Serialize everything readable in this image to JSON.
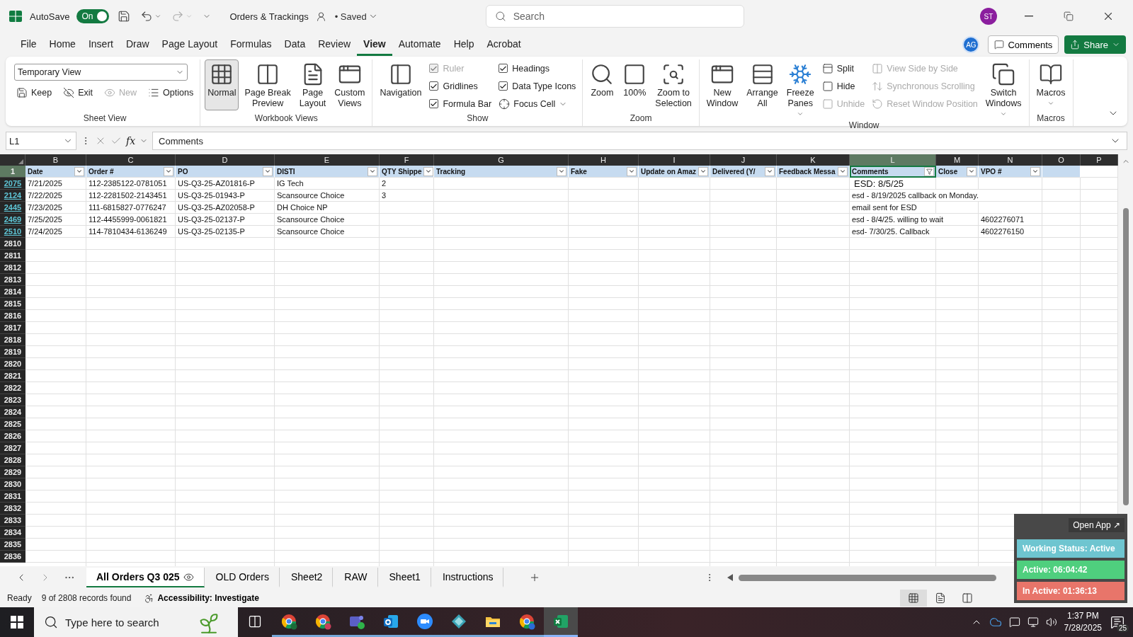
{
  "title_bar": {
    "autosave_label": "AutoSave",
    "autosave": {
      "label": "On",
      "on": true
    },
    "document_title": "Orders & Trackings",
    "save_status": "• Saved",
    "search": {
      "placeholder": "Search"
    },
    "user_initials": "ST"
  },
  "menu_tabs": [
    {
      "label": "File",
      "selected": false
    },
    {
      "label": "Home",
      "selected": false
    },
    {
      "label": "Insert",
      "selected": false
    },
    {
      "label": "Draw",
      "selected": false
    },
    {
      "label": "Page Layout",
      "selected": false
    },
    {
      "label": "Formulas",
      "selected": false
    },
    {
      "label": "Data",
      "selected": false
    },
    {
      "label": "Review",
      "selected": false
    },
    {
      "label": "View",
      "selected": true
    },
    {
      "label": "Automate",
      "selected": false
    },
    {
      "label": "Help",
      "selected": false
    },
    {
      "label": "Acrobat",
      "selected": false
    }
  ],
  "account": {
    "initials": "AG",
    "comments_button": "Comments",
    "share_button": "Share"
  },
  "ribbon": {
    "groups": [
      {
        "label": "Sheet View",
        "items": [
          {
            "kind": "dropdown",
            "lines": [
              "Temporary View"
            ],
            "disabled": false
          },
          {
            "kind": "small",
            "lines": [
              "Keep"
            ],
            "disabled": false
          },
          {
            "kind": "small",
            "lines": [
              "Exit"
            ],
            "disabled": false
          },
          {
            "kind": "small",
            "lines": [
              "New"
            ],
            "disabled": true
          },
          {
            "kind": "small",
            "lines": [
              "Options"
            ],
            "disabled": false
          }
        ]
      },
      {
        "label": "Workbook Views",
        "items": [
          {
            "kind": "large",
            "lines": [
              "Normal"
            ],
            "disabled": false,
            "selected": true
          },
          {
            "kind": "large",
            "lines": [
              "Page Break",
              "Preview"
            ],
            "disabled": false,
            "selected": false
          },
          {
            "kind": "large",
            "lines": [
              "Page",
              "Layout"
            ],
            "disabled": false,
            "selected": false
          },
          {
            "kind": "large",
            "lines": [
              "Custom",
              "Views"
            ],
            "disabled": false,
            "selected": false
          }
        ]
      },
      {
        "label": "Show",
        "items": [
          {
            "kind": "large",
            "lines": [
              "Navigation"
            ],
            "disabled": false
          },
          {
            "kind": "check",
            "lines": [
              "Ruler"
            ],
            "checked": true,
            "disabled": true
          },
          {
            "kind": "check",
            "lines": [
              "Gridlines"
            ],
            "checked": true,
            "disabled": false
          },
          {
            "kind": "check",
            "lines": [
              "Formula Bar"
            ],
            "checked": true,
            "disabled": false
          },
          {
            "kind": "check",
            "lines": [
              "Headings"
            ],
            "checked": true,
            "disabled": false
          },
          {
            "kind": "check",
            "lines": [
              "Data Type Icons"
            ],
            "checked": true,
            "disabled": false
          },
          {
            "kind": "small",
            "lines": [
              "Focus Cell"
            ],
            "disabled": false,
            "has_menu": true
          }
        ]
      },
      {
        "label": "Zoom",
        "items": [
          {
            "kind": "large",
            "lines": [
              "Zoom"
            ],
            "disabled": false
          },
          {
            "kind": "large",
            "lines": [
              "100%"
            ],
            "disabled": false
          },
          {
            "kind": "large",
            "lines": [
              "Zoom to",
              "Selection"
            ],
            "disabled": false
          }
        ]
      },
      {
        "label": "Window",
        "items": [
          {
            "kind": "large",
            "lines": [
              "New",
              "Window"
            ],
            "disabled": false
          },
          {
            "kind": "large",
            "lines": [
              "Arrange",
              "All"
            ],
            "disabled": false
          },
          {
            "kind": "large",
            "lines": [
              "Freeze",
              "Panes"
            ],
            "disabled": false,
            "has_menu": true
          },
          {
            "kind": "small",
            "lines": [
              "Split"
            ],
            "disabled": false
          },
          {
            "kind": "small",
            "lines": [
              "Hide"
            ],
            "disabled": false
          },
          {
            "kind": "small",
            "lines": [
              "Unhide"
            ],
            "disabled": true
          },
          {
            "kind": "small",
            "lines": [
              "View Side by Side"
            ],
            "disabled": true
          },
          {
            "kind": "small",
            "lines": [
              "Synchronous Scrolling"
            ],
            "disabled": true
          },
          {
            "kind": "small",
            "lines": [
              "Reset Window Position"
            ],
            "disabled": true
          },
          {
            "kind": "large",
            "lines": [
              "Switch",
              "Windows"
            ],
            "disabled": false,
            "has_menu": true
          }
        ]
      },
      {
        "label": "Macros",
        "items": [
          {
            "kind": "large",
            "lines": [
              "Macros"
            ],
            "disabled": false,
            "has_menu": true
          }
        ]
      }
    ]
  },
  "formula_bar": {
    "name_box": "L1",
    "function_label": "fx",
    "value": "Comments"
  },
  "sheet": {
    "header_row_number": "1",
    "columns": [
      {
        "letter": "B",
        "kind": "header",
        "header": "Date",
        "selected": false,
        "filter_applied": false
      },
      {
        "letter": "C",
        "kind": "header",
        "header": "Order #",
        "selected": false,
        "filter_applied": false
      },
      {
        "letter": "D",
        "kind": "header",
        "header": "PO",
        "selected": false,
        "filter_applied": false
      },
      {
        "letter": "E",
        "kind": "header",
        "header": "DISTI",
        "selected": false,
        "filter_applied": false
      },
      {
        "letter": "F",
        "kind": "header",
        "header": "QTY Shippe",
        "selected": false,
        "filter_applied": false
      },
      {
        "letter": "G",
        "kind": "header",
        "header": "Tracking",
        "selected": false,
        "filter_applied": false
      },
      {
        "letter": "H",
        "kind": "header",
        "header": "Fake",
        "selected": false,
        "filter_applied": false
      },
      {
        "letter": "I",
        "kind": "header",
        "header": "Update on Amaz",
        "selected": false,
        "filter_applied": false
      },
      {
        "letter": "J",
        "kind": "header",
        "header": "Delivered (Y/",
        "selected": false,
        "filter_applied": false
      },
      {
        "letter": "K",
        "kind": "header",
        "header": "Feedback Messa",
        "selected": false,
        "filter_applied": false
      },
      {
        "letter": "L",
        "kind": "header",
        "header": "Comments",
        "selected": true,
        "filter_applied": true
      },
      {
        "letter": "M",
        "kind": "header",
        "header": "Close",
        "selected": false,
        "filter_applied": false
      },
      {
        "letter": "N",
        "kind": "header",
        "header": "VPO #",
        "selected": false,
        "filter_applied": false
      },
      {
        "letter": "O",
        "kind": "shaded",
        "selected": false
      },
      {
        "letter": "P",
        "kind": "plain",
        "selected": false
      }
    ],
    "rows": [
      {
        "number": "2075",
        "filtered": true,
        "cells": [
          {
            "text": "7/21/2025",
            "large": false
          },
          {
            "text": "112-2385122-0781051",
            "large": false
          },
          {
            "text": "US-Q3-25-AZ01816-P",
            "large": false
          },
          {
            "text": "IG Tech",
            "large": false
          },
          {
            "text": "2",
            "large": false
          },
          null,
          null,
          null,
          null,
          null,
          {
            "text": "ESD:  8/5/25",
            "large": true
          },
          null,
          null,
          null,
          null
        ]
      },
      {
        "number": "2124",
        "filtered": true,
        "cells": [
          {
            "text": "7/22/2025",
            "large": false
          },
          {
            "text": "112-2281502-2143451",
            "large": false
          },
          {
            "text": "US-Q3-25-01943-P",
            "large": false
          },
          {
            "text": "Scansource Choice",
            "large": false
          },
          {
            "text": "3",
            "large": false
          },
          null,
          null,
          null,
          null,
          null,
          {
            "text": "esd - 8/19/2025 callback on Monday.",
            "large": false
          },
          null,
          null,
          null,
          null
        ]
      },
      {
        "number": "2445",
        "filtered": true,
        "cells": [
          {
            "text": "7/23/2025",
            "large": false
          },
          {
            "text": "111-6815827-0776247",
            "large": false
          },
          {
            "text": "US-Q3-25-AZ02058-P",
            "large": false
          },
          {
            "text": "DH Choice NP",
            "large": false
          },
          null,
          null,
          null,
          null,
          null,
          null,
          {
            "text": "email sent for ESD",
            "large": false
          },
          null,
          null,
          null,
          null
        ]
      },
      {
        "number": "2469",
        "filtered": true,
        "cells": [
          {
            "text": "7/25/2025",
            "large": false
          },
          {
            "text": "112-4455999-0061821",
            "large": false
          },
          {
            "text": "US-Q3-25-02137-P",
            "large": false
          },
          {
            "text": "Scansource Choice",
            "large": false
          },
          null,
          null,
          null,
          null,
          null,
          null,
          {
            "text": "esd - 8/4/25. willing to wait",
            "large": false
          },
          null,
          {
            "text": "4602276071",
            "large": false
          },
          null,
          null
        ]
      },
      {
        "number": "2510",
        "filtered": true,
        "cells": [
          {
            "text": "7/24/2025",
            "large": false
          },
          {
            "text": "114-7810434-6136249",
            "large": false
          },
          {
            "text": "US-Q3-25-02135-P",
            "large": false
          },
          {
            "text": "Scansource Choice",
            "large": false
          },
          null,
          null,
          null,
          null,
          null,
          null,
          {
            "text": "esd- 7/30/25. Callback",
            "large": false
          },
          null,
          {
            "text": "4602276150",
            "large": false
          },
          null,
          null
        ]
      },
      {
        "number": "2810",
        "filtered": false
      },
      {
        "number": "2811",
        "filtered": false
      },
      {
        "number": "2812",
        "filtered": false
      },
      {
        "number": "2813",
        "filtered": false
      },
      {
        "number": "2814",
        "filtered": false
      },
      {
        "number": "2815",
        "filtered": false
      },
      {
        "number": "2816",
        "filtered": false
      },
      {
        "number": "2817",
        "filtered": false
      },
      {
        "number": "2818",
        "filtered": false
      },
      {
        "number": "2819",
        "filtered": false
      },
      {
        "number": "2820",
        "filtered": false
      },
      {
        "number": "2821",
        "filtered": false
      },
      {
        "number": "2822",
        "filtered": false
      },
      {
        "number": "2823",
        "filtered": false
      },
      {
        "number": "2824",
        "filtered": false
      },
      {
        "number": "2825",
        "filtered": false
      },
      {
        "number": "2826",
        "filtered": false
      },
      {
        "number": "2827",
        "filtered": false
      },
      {
        "number": "2828",
        "filtered": false
      },
      {
        "number": "2829",
        "filtered": false
      },
      {
        "number": "2830",
        "filtered": false
      },
      {
        "number": "2831",
        "filtered": false
      },
      {
        "number": "2832",
        "filtered": false
      },
      {
        "number": "2833",
        "filtered": false
      },
      {
        "number": "2834",
        "filtered": false
      },
      {
        "number": "2835",
        "filtered": false
      },
      {
        "number": "2836",
        "filtered": false
      }
    ]
  },
  "sheet_tabs": [
    {
      "label": "All Orders Q3 025",
      "selected": true,
      "view_icon": true
    },
    {
      "label": "OLD Orders",
      "selected": false,
      "view_icon": false
    },
    {
      "label": "Sheet2",
      "selected": false,
      "view_icon": false
    },
    {
      "label": "RAW",
      "selected": false,
      "view_icon": false
    },
    {
      "label": "Sheet1",
      "selected": false,
      "view_icon": false
    },
    {
      "label": "Instructions",
      "selected": false,
      "view_icon": false
    }
  ],
  "status_bar": {
    "mode": "Ready",
    "records": "9 of 2808 records found",
    "accessibility": "Accessibility: Investigate",
    "views": [
      {
        "selected": true
      },
      {
        "selected": false
      },
      {
        "selected": false
      }
    ]
  },
  "tracker_widget": {
    "open_app": "Open App ↗",
    "statuses": [
      {
        "label": "Working Status: Active",
        "color": "#6ec5d0"
      },
      {
        "label": "Active: 06:04:42",
        "color": "#4fcf7e"
      },
      {
        "label": "In Active: 01:36:13",
        "color": "#e8756a"
      }
    ]
  },
  "taskbar": {
    "search_placeholder": "Type here to search",
    "apps": [
      {
        "active": false
      },
      {
        "active": false
      },
      {
        "active": false
      },
      {
        "active": false
      },
      {
        "active": false
      },
      {
        "active": false
      },
      {
        "active": false
      },
      {
        "active": false
      },
      {
        "active": true
      }
    ],
    "time": "1:37 PM",
    "date": "7/28/2025",
    "notifications": "25"
  }
}
